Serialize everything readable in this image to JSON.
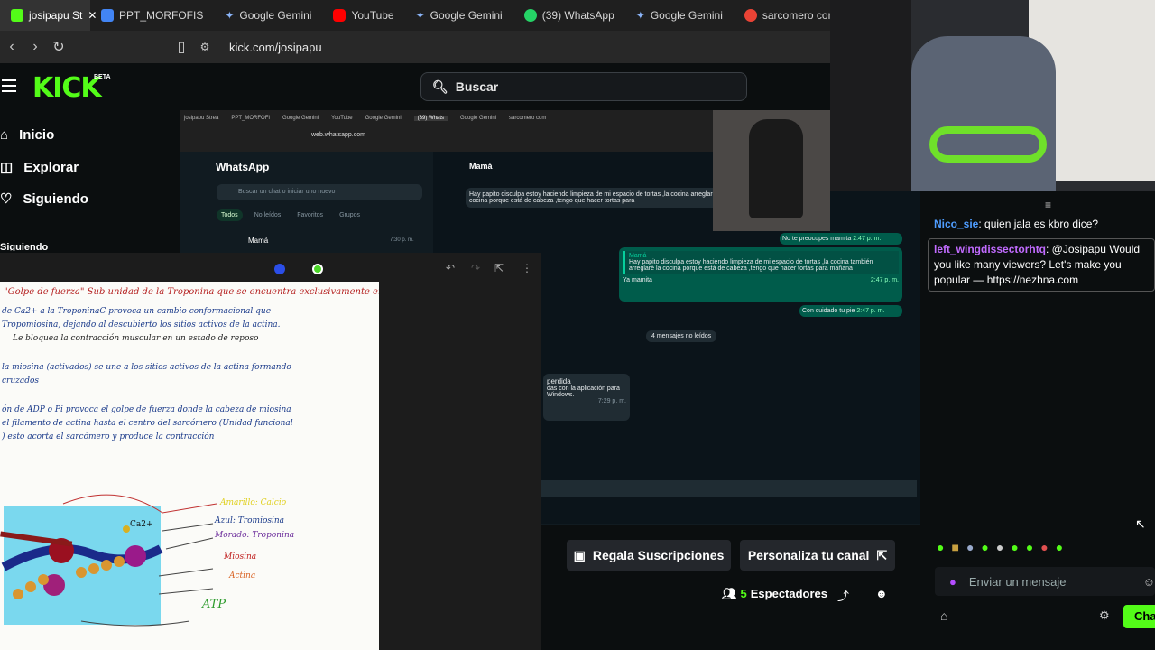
{
  "browser": {
    "tabs": [
      {
        "label": "josipapu St",
        "icon": "kick-icon",
        "color": "#53fc18"
      },
      {
        "label": "PPT_MORFOFIS",
        "icon": "docs-icon",
        "color": "#4285f4"
      },
      {
        "label": "Google Gemini",
        "icon": "gemini-icon",
        "color": "#8ab4f8"
      },
      {
        "label": "YouTube",
        "icon": "youtube-icon",
        "color": "#ff0000"
      },
      {
        "label": "Google Gemini",
        "icon": "gemini-icon",
        "color": "#8ab4f8"
      },
      {
        "label": "(39) WhatsApp",
        "icon": "whatsapp-icon",
        "color": "#25d366"
      },
      {
        "label": "Google Gemini",
        "icon": "gemini-icon",
        "color": "#8ab4f8"
      },
      {
        "label": "sarcomero com",
        "icon": "google-icon",
        "color": "#ea4335"
      }
    ],
    "url": "kick.com/josipapu"
  },
  "kick": {
    "logo": "KICK",
    "beta": "BETA",
    "search_label": "Buscar",
    "nav": [
      "Inicio",
      "Explorar",
      "Siguiendo"
    ],
    "section": "Siguiendo"
  },
  "stream": {
    "inner_browser": {
      "tabs": [
        "josipapu Strea",
        "PPT_MORFOFI",
        "Google Gemini",
        "YouTube",
        "Google Gemini",
        "(39) Whats",
        "Google Gemini",
        "sarcomero com"
      ],
      "url": "web.whatsapp.com"
    },
    "whatsapp": {
      "title": "WhatsApp",
      "search_placeholder": "Buscar un chat o iniciar uno nuevo",
      "filters": [
        "Todos",
        "No leídos",
        "Favoritos",
        "Grupos"
      ],
      "chat_name": "Mamá",
      "chat_time": "7:30 p. m.",
      "contact": "Mamá",
      "incoming_1": "Hay papito disculpa estoy haciendo limpieza de mi espacio de tortas ,la cocina arreglaré la cocina porque está de cabeza ,tengo que hacer tortas para",
      "out_1": "No te preocupes mamita",
      "out_1_time": "2:47 p. m.",
      "quote_author": "Mamá",
      "quote_text": "Hay papito disculpa estoy haciendo limpieza de mi espacio de tortas ,la cocina también arreglaré la cocina porque está de cabeza ,tengo que hacer tortas para mañana",
      "out_2": "Ya mamita",
      "out_2_time": "2:47 p. m.",
      "out_3": "Con cuidado tu pie",
      "out_3_time": "2:47 p. m.",
      "unread": "4 mensajes no leídos",
      "missed": "perdida",
      "missed_sub": "das con la aplicación para Windows.",
      "missed_time": "7:29 p. m."
    },
    "notes": {
      "lines": [
        "\"Golpe de fuerza\" Sub unidad de la Troponina que se encuentra exclusivamente en el músculo estriado. Unir Ca2+ para iniciar la contracción muscular",
        "de Ca2+ a la TroponinaC provoca un cambio conformacional que",
        "Tropomiosina, dejando al descubierto los sitios activos de la actina.",
        "Le bloquea la contracción muscular en un estado de reposo",
        "la miosina (activados) se une a los sitios activos de la actina formando",
        "cruzados",
        "ón de ADP o Pi provoca el golpe de fuerza donde la cabeza de miosina",
        "el filamento de actina hasta el centro del sarcómero (Unidad funcional",
        ") esto acorta el sarcómero y produce la contracción"
      ],
      "diagram_labels": [
        "Amarillo: Calcio",
        "Azul: Tromiosina",
        "Morado: Troponina",
        "Miosina",
        "Actina",
        "ATP"
      ],
      "ion_label": "Ca2+"
    }
  },
  "actions": {
    "gift": "Regala Suscripciones",
    "customize": "Personaliza tu canal",
    "viewers_count": "5",
    "viewers_label": "Espectadores"
  },
  "chat": {
    "messages": [
      {
        "user": "Nico_sie",
        "color": "#4f9dff",
        "text": ": quien jala es kbro dice?"
      },
      {
        "user": "left_wingdissectorhtq",
        "color": "#c16bff",
        "text": ": @Josipapu Would you like many viewers? Let's make you popular — https://nezhna.com"
      }
    ],
    "input_placeholder": "Enviar un mensaje",
    "send_label": "Cha"
  }
}
